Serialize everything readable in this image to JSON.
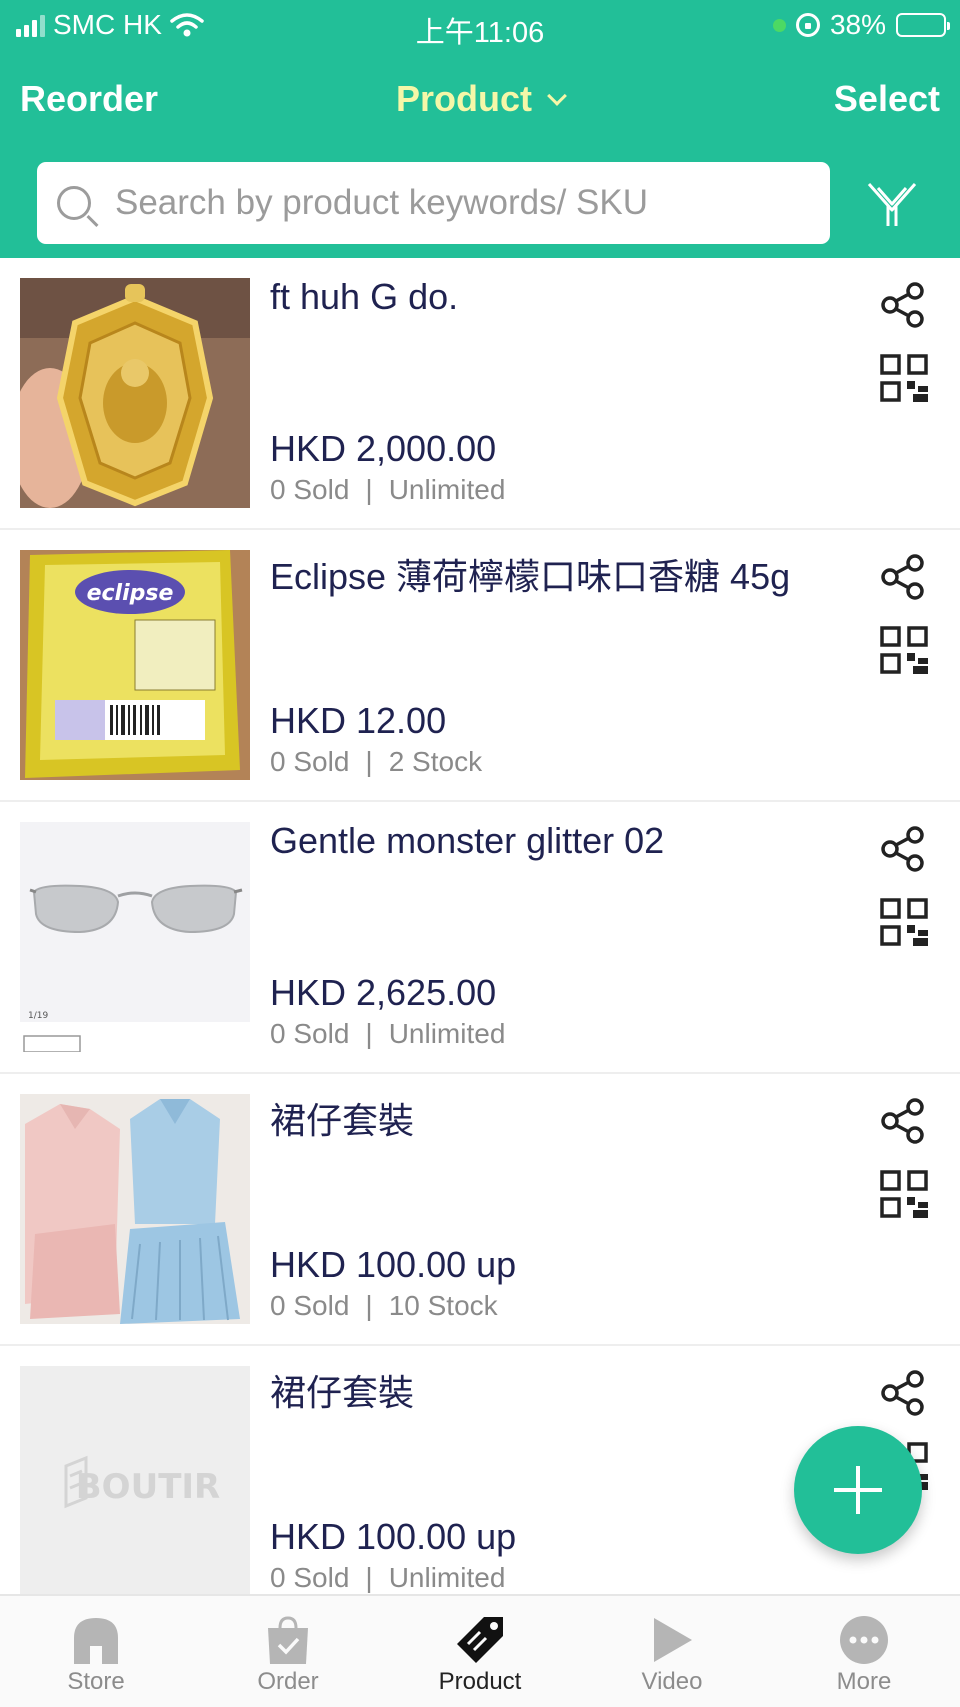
{
  "status_bar": {
    "carrier": "SMC HK",
    "time": "上午11:06",
    "battery": "38%"
  },
  "nav": {
    "left_label": "Reorder",
    "title": "Product",
    "right_label": "Select"
  },
  "search": {
    "placeholder": "Search by product keywords/ SKU"
  },
  "products": [
    {
      "name": "ft huh G do.",
      "price": "HKD 2,000.00",
      "sold": "0 Sold",
      "stock": "Unlimited"
    },
    {
      "name": "Eclipse 薄荷檸檬口味口香糖 45g",
      "price": "HKD 12.00",
      "sold": "0 Sold",
      "stock": "2 Stock"
    },
    {
      "name": "Gentle monster glitter 02",
      "price": "HKD 2,625.00",
      "sold": "0 Sold",
      "stock": "Unlimited",
      "image_caption": "1/19"
    },
    {
      "name": "裙仔套裝",
      "price": "HKD 100.00 up",
      "sold": "0 Sold",
      "stock": "10 Stock"
    },
    {
      "name": "裙仔套裝",
      "price": "HKD 100.00 up",
      "sold": "0 Sold",
      "stock": "Unlimited",
      "placeholder_logo": "BOUTIR"
    }
  ],
  "separator": "|",
  "tabs": [
    {
      "label": "Store",
      "icon": "store-icon"
    },
    {
      "label": "Order",
      "icon": "order-bag-icon"
    },
    {
      "label": "Product",
      "icon": "product-tag-icon"
    },
    {
      "label": "Video",
      "icon": "video-play-icon"
    },
    {
      "label": "More",
      "icon": "more-dots-icon"
    }
  ],
  "active_tab": "Product",
  "colors": {
    "brand": "#22bf98",
    "title_accent": "#f5f7a8",
    "text_primary": "#1f2250",
    "text_secondary": "#8a8a8a"
  }
}
